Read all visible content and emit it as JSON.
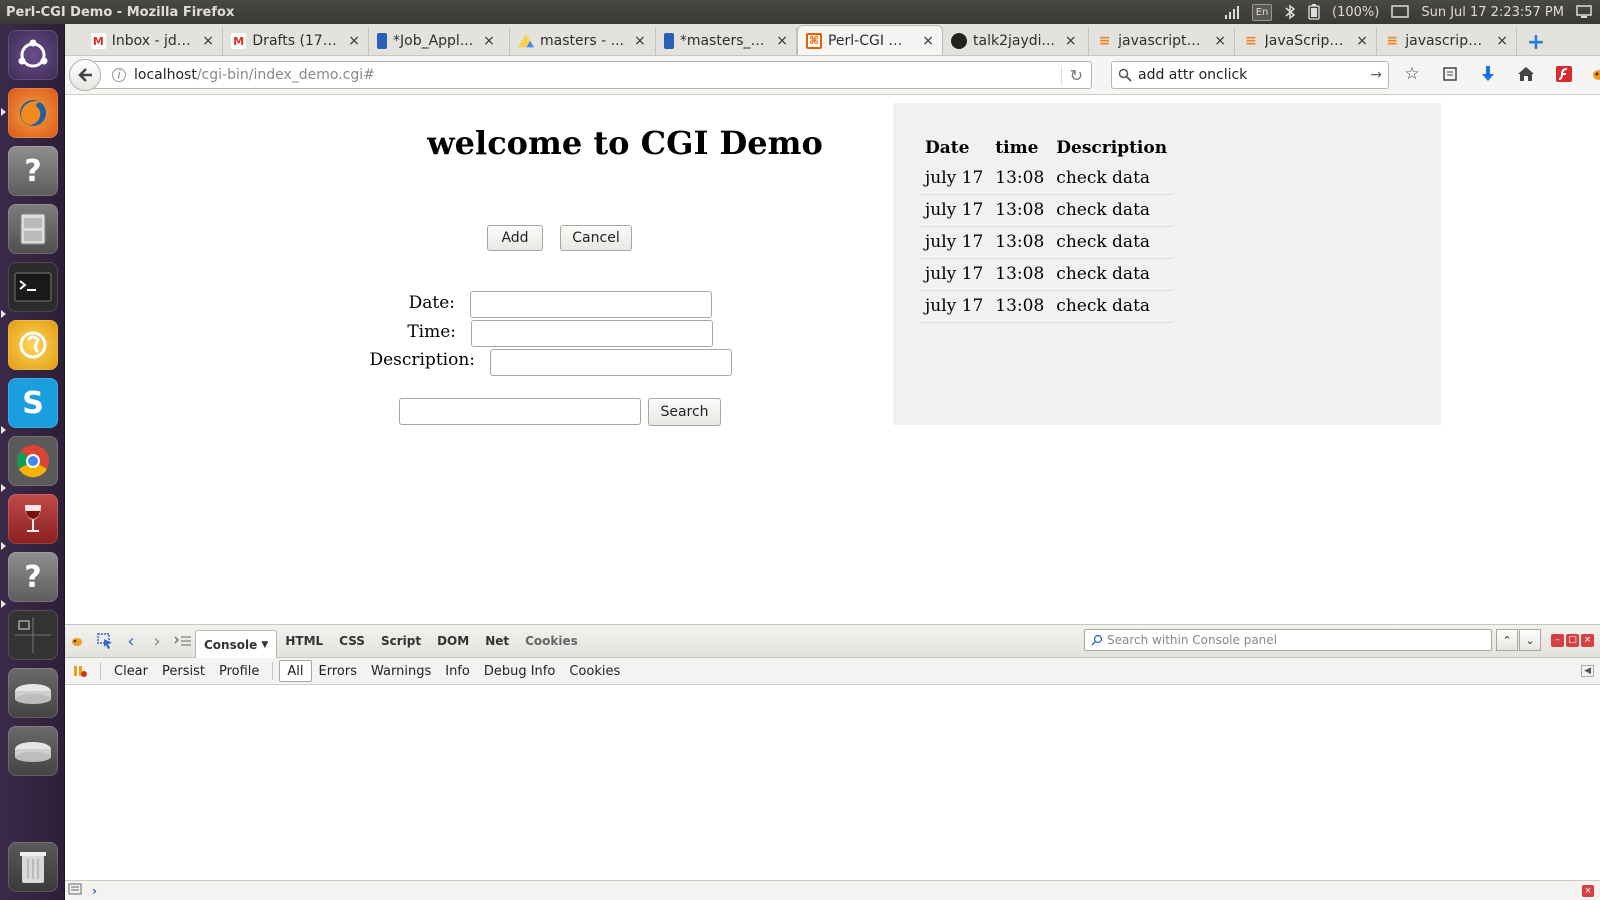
{
  "window": {
    "title": "Perl-CGI Demo - Mozilla Firefox"
  },
  "tray": {
    "keyboard": "En",
    "battery": "(100%)",
    "clock": "Sun Jul 17  2:23:57 PM"
  },
  "tabs": [
    {
      "label": "Inbox - jd6...",
      "icon": "gmail-icon",
      "color": "#d93025",
      "active": false
    },
    {
      "label": "Drafts (17)...",
      "icon": "gmail-icon",
      "color": "#d93025",
      "active": false
    },
    {
      "label": "*Job_Appl...",
      "icon": "docs-icon",
      "color": "#2b5eb8",
      "active": false
    },
    {
      "label": "masters - ...",
      "icon": "drive-icon",
      "color": "#1fa463",
      "active": false
    },
    {
      "label": "*masters_i...",
      "icon": "docs-icon",
      "color": "#2b5eb8",
      "active": false
    },
    {
      "label": "Perl-CGI D...",
      "icon": "page-icon",
      "color": "#e66000",
      "active": true
    },
    {
      "label": "talk2jaydi...",
      "icon": "github-icon",
      "color": "#222222",
      "active": false
    },
    {
      "label": "javascript -...",
      "icon": "stackoverflow-icon",
      "color": "#f48024",
      "active": false
    },
    {
      "label": "JavaScript...",
      "icon": "stackoverflow-icon",
      "color": "#f48024",
      "active": false
    },
    {
      "label": "javascript -...",
      "icon": "stackoverflow-icon",
      "color": "#f48024",
      "active": false
    }
  ],
  "url": {
    "host": "localhost",
    "path": "/cgi-bin/index_demo.cgi#"
  },
  "search": {
    "value": "add attr onclick"
  },
  "page": {
    "heading": "welcome to CGI Demo",
    "add_label": "Add",
    "cancel_label": "Cancel",
    "date_label": "Date:",
    "time_label": "Time:",
    "description_label": "Description:",
    "date_value": "",
    "time_value": "",
    "description_value": "",
    "search_value": "",
    "search_label": "Search"
  },
  "table": {
    "headers": [
      "Date",
      "time",
      "Description"
    ],
    "rows": [
      [
        "july 17",
        "13:08",
        "check data"
      ],
      [
        "july 17",
        "13:08",
        "check data"
      ],
      [
        "july 17",
        "13:08",
        "check data"
      ],
      [
        "july 17",
        "13:08",
        "check data"
      ],
      [
        "july 17",
        "13:08",
        "check data"
      ]
    ]
  },
  "firebug": {
    "tabs": [
      "Console",
      "HTML",
      "CSS",
      "Script",
      "DOM",
      "Net",
      "Cookies"
    ],
    "active_tab": "Console",
    "search_placeholder": "Search within Console panel",
    "sub_left": [
      "Clear",
      "Persist",
      "Profile"
    ],
    "filters": [
      "All",
      "Errors",
      "Warnings",
      "Info",
      "Debug Info",
      "Cookies"
    ],
    "active_filter": "All"
  }
}
